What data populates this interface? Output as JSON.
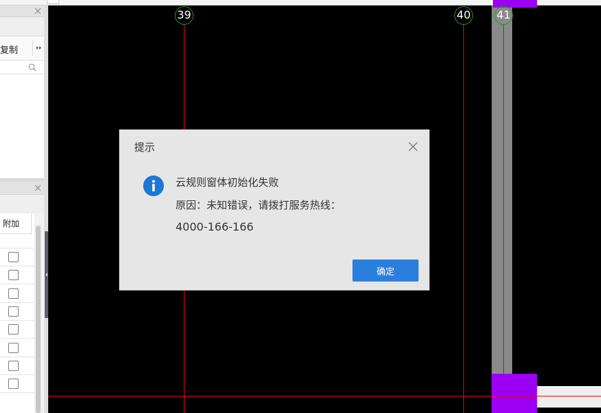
{
  "left_panel": {
    "top_section": {
      "close_icon": "close-icon",
      "copy_label": "复制",
      "more_icon": "double-chevron-right-icon",
      "search_value": "",
      "search_icon": "search-icon"
    },
    "bottom_section": {
      "close_icon": "close-icon",
      "column_header": "附加",
      "rows": [
        {
          "checked": false
        },
        {
          "checked": false
        },
        {
          "checked": false
        },
        {
          "checked": false
        },
        {
          "checked": false
        },
        {
          "checked": false
        },
        {
          "checked": false
        },
        {
          "checked": false
        }
      ]
    },
    "splitter_icon": "collapse-left-icon"
  },
  "canvas": {
    "axes": [
      {
        "label": "39"
      },
      {
        "label": "40"
      },
      {
        "label": "41"
      }
    ]
  },
  "dialog": {
    "title": "提示",
    "close_icon": "close-icon",
    "info_icon": "info-icon",
    "message": "云规则窗体初始化失败",
    "reason": "原因：未知错误，请拨打服务热线：",
    "phone": "4000-166-166",
    "ok_label": "确定"
  },
  "colors": {
    "canvas-bg": "#000000",
    "grid": "#ff0000",
    "axis": "#1f9a2a",
    "col": "#8a8a8a",
    "purple": "#9b00f5",
    "dlg": "#e6e6e6",
    "btn": "#2b7fdc",
    "info": "#1c78d4"
  }
}
